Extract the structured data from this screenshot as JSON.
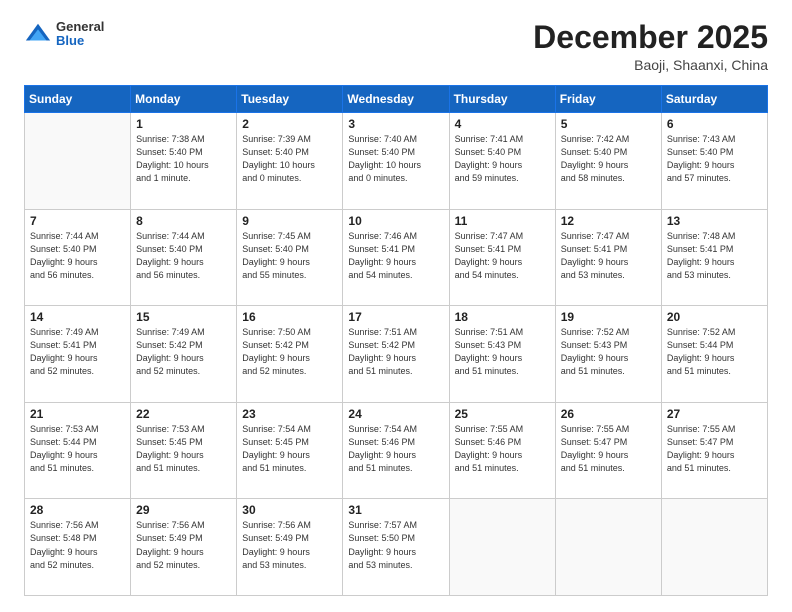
{
  "header": {
    "logo": {
      "general": "General",
      "blue": "Blue"
    },
    "title": "December 2025",
    "location": "Baoji, Shaanxi, China"
  },
  "days_of_week": [
    "Sunday",
    "Monday",
    "Tuesday",
    "Wednesday",
    "Thursday",
    "Friday",
    "Saturday"
  ],
  "weeks": [
    [
      {
        "day": "",
        "info": ""
      },
      {
        "day": "1",
        "info": "Sunrise: 7:38 AM\nSunset: 5:40 PM\nDaylight: 10 hours\nand 1 minute."
      },
      {
        "day": "2",
        "info": "Sunrise: 7:39 AM\nSunset: 5:40 PM\nDaylight: 10 hours\nand 0 minutes."
      },
      {
        "day": "3",
        "info": "Sunrise: 7:40 AM\nSunset: 5:40 PM\nDaylight: 10 hours\nand 0 minutes."
      },
      {
        "day": "4",
        "info": "Sunrise: 7:41 AM\nSunset: 5:40 PM\nDaylight: 9 hours\nand 59 minutes."
      },
      {
        "day": "5",
        "info": "Sunrise: 7:42 AM\nSunset: 5:40 PM\nDaylight: 9 hours\nand 58 minutes."
      },
      {
        "day": "6",
        "info": "Sunrise: 7:43 AM\nSunset: 5:40 PM\nDaylight: 9 hours\nand 57 minutes."
      }
    ],
    [
      {
        "day": "7",
        "info": "Sunrise: 7:44 AM\nSunset: 5:40 PM\nDaylight: 9 hours\nand 56 minutes."
      },
      {
        "day": "8",
        "info": "Sunrise: 7:44 AM\nSunset: 5:40 PM\nDaylight: 9 hours\nand 56 minutes."
      },
      {
        "day": "9",
        "info": "Sunrise: 7:45 AM\nSunset: 5:40 PM\nDaylight: 9 hours\nand 55 minutes."
      },
      {
        "day": "10",
        "info": "Sunrise: 7:46 AM\nSunset: 5:41 PM\nDaylight: 9 hours\nand 54 minutes."
      },
      {
        "day": "11",
        "info": "Sunrise: 7:47 AM\nSunset: 5:41 PM\nDaylight: 9 hours\nand 54 minutes."
      },
      {
        "day": "12",
        "info": "Sunrise: 7:47 AM\nSunset: 5:41 PM\nDaylight: 9 hours\nand 53 minutes."
      },
      {
        "day": "13",
        "info": "Sunrise: 7:48 AM\nSunset: 5:41 PM\nDaylight: 9 hours\nand 53 minutes."
      }
    ],
    [
      {
        "day": "14",
        "info": "Sunrise: 7:49 AM\nSunset: 5:41 PM\nDaylight: 9 hours\nand 52 minutes."
      },
      {
        "day": "15",
        "info": "Sunrise: 7:49 AM\nSunset: 5:42 PM\nDaylight: 9 hours\nand 52 minutes."
      },
      {
        "day": "16",
        "info": "Sunrise: 7:50 AM\nSunset: 5:42 PM\nDaylight: 9 hours\nand 52 minutes."
      },
      {
        "day": "17",
        "info": "Sunrise: 7:51 AM\nSunset: 5:42 PM\nDaylight: 9 hours\nand 51 minutes."
      },
      {
        "day": "18",
        "info": "Sunrise: 7:51 AM\nSunset: 5:43 PM\nDaylight: 9 hours\nand 51 minutes."
      },
      {
        "day": "19",
        "info": "Sunrise: 7:52 AM\nSunset: 5:43 PM\nDaylight: 9 hours\nand 51 minutes."
      },
      {
        "day": "20",
        "info": "Sunrise: 7:52 AM\nSunset: 5:44 PM\nDaylight: 9 hours\nand 51 minutes."
      }
    ],
    [
      {
        "day": "21",
        "info": "Sunrise: 7:53 AM\nSunset: 5:44 PM\nDaylight: 9 hours\nand 51 minutes."
      },
      {
        "day": "22",
        "info": "Sunrise: 7:53 AM\nSunset: 5:45 PM\nDaylight: 9 hours\nand 51 minutes."
      },
      {
        "day": "23",
        "info": "Sunrise: 7:54 AM\nSunset: 5:45 PM\nDaylight: 9 hours\nand 51 minutes."
      },
      {
        "day": "24",
        "info": "Sunrise: 7:54 AM\nSunset: 5:46 PM\nDaylight: 9 hours\nand 51 minutes."
      },
      {
        "day": "25",
        "info": "Sunrise: 7:55 AM\nSunset: 5:46 PM\nDaylight: 9 hours\nand 51 minutes."
      },
      {
        "day": "26",
        "info": "Sunrise: 7:55 AM\nSunset: 5:47 PM\nDaylight: 9 hours\nand 51 minutes."
      },
      {
        "day": "27",
        "info": "Sunrise: 7:55 AM\nSunset: 5:47 PM\nDaylight: 9 hours\nand 51 minutes."
      }
    ],
    [
      {
        "day": "28",
        "info": "Sunrise: 7:56 AM\nSunset: 5:48 PM\nDaylight: 9 hours\nand 52 minutes."
      },
      {
        "day": "29",
        "info": "Sunrise: 7:56 AM\nSunset: 5:49 PM\nDaylight: 9 hours\nand 52 minutes."
      },
      {
        "day": "30",
        "info": "Sunrise: 7:56 AM\nSunset: 5:49 PM\nDaylight: 9 hours\nand 53 minutes."
      },
      {
        "day": "31",
        "info": "Sunrise: 7:57 AM\nSunset: 5:50 PM\nDaylight: 9 hours\nand 53 minutes."
      },
      {
        "day": "",
        "info": ""
      },
      {
        "day": "",
        "info": ""
      },
      {
        "day": "",
        "info": ""
      }
    ]
  ]
}
